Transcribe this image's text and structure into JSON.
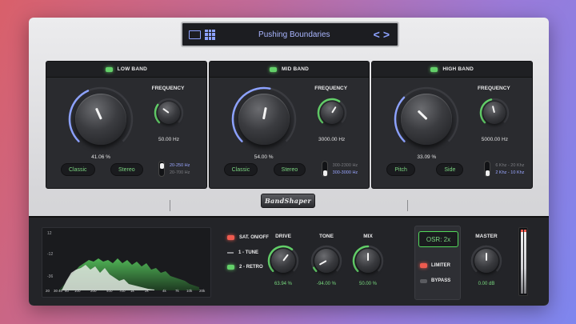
{
  "preset": {
    "name": "Pushing Boundaries",
    "prev_label": "<",
    "next_label": ">"
  },
  "logo": "BandShaper",
  "bands": [
    {
      "title": "LOW BAND",
      "main_value": "41.06 %",
      "frequency_label": "FREQUENCY",
      "frequency_value": "50.00 Hz",
      "buttons": [
        "Classic",
        "Stereo"
      ],
      "options": [
        "20-250 Hz",
        "20-700 Hz"
      ],
      "selected_option": 0,
      "main_knob_level": 0.41,
      "freq_knob_level": 0.3
    },
    {
      "title": "MID BAND",
      "main_value": "54.00 %",
      "frequency_label": "FREQUENCY",
      "frequency_value": "3000.00 Hz",
      "buttons": [
        "Classic",
        "Stereo"
      ],
      "options": [
        "300-2300 Hz",
        "300-3000 Hz"
      ],
      "selected_option": 1,
      "main_knob_level": 0.54,
      "freq_knob_level": 0.62
    },
    {
      "title": "HIGH BAND",
      "main_value": "33.09 %",
      "frequency_label": "FREQUENCY",
      "frequency_value": "5000.00 Hz",
      "buttons": [
        "Pitch",
        "Side"
      ],
      "options": [
        "6 Khz - 20 Khz",
        "2 Khz - 10 Khz"
      ],
      "selected_option": 1,
      "main_knob_level": 0.33,
      "freq_knob_level": 0.45
    }
  ],
  "analyzer": {
    "y_labels": [
      "12",
      "-12",
      "-36"
    ],
    "x_labels": [
      "20",
      "30",
      "40",
      "60",
      "100",
      "200",
      "400",
      "700",
      "1k",
      "2k",
      "4k",
      "7k",
      "10k",
      "20k"
    ]
  },
  "modes": [
    {
      "label": "SAT. ON/OFF",
      "state": "red"
    },
    {
      "label": "1 - TUNE",
      "state": "dash"
    },
    {
      "label": "2 - RETRO",
      "state": "green"
    }
  ],
  "controls": [
    {
      "label": "DRIVE",
      "value": "63.94 %",
      "level": 0.64
    },
    {
      "label": "TONE",
      "value": "-94.00 %",
      "level": 0.06
    },
    {
      "label": "MIX",
      "value": "50.00 %",
      "level": 0.5
    }
  ],
  "osr": {
    "label": "OSR:",
    "value": "2x"
  },
  "limiter": {
    "label": "LIMITER",
    "state": "red"
  },
  "bypass": {
    "label": "BYPASS",
    "state": "off"
  },
  "master": {
    "label": "MASTER",
    "value": "0.00 dB",
    "level": 0.5
  },
  "colors": {
    "accent_blue": "#8da2ff",
    "accent_green": "#63d069",
    "accent_red": "#ef5b4f",
    "panel": "#2a2b2f"
  }
}
